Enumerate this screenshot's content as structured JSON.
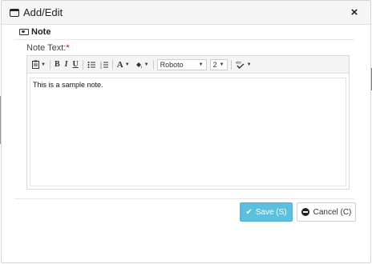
{
  "dialog": {
    "title": "Add/Edit",
    "close_symbol": "×"
  },
  "section": {
    "label": "Note",
    "icon": "note-icon"
  },
  "field": {
    "label": "Note Text:",
    "required_marker": "*"
  },
  "toolbar": {
    "bold": "B",
    "italic": "I",
    "underline": "U",
    "font_color": "A",
    "font_name": "Roboto",
    "font_size": "2",
    "icons": [
      "paste-icon",
      "bold-icon",
      "italic-icon",
      "underline-icon",
      "unordered-list-icon",
      "ordered-list-icon",
      "font-color-icon",
      "background-color-icon",
      "spellcheck-icon"
    ]
  },
  "editor": {
    "content": "This is a sample note."
  },
  "buttons": {
    "save_label": "Save (S)",
    "cancel_label": "Cancel (C)"
  },
  "colors": {
    "save_button": "#5bc0de",
    "required": "#d9000d"
  }
}
